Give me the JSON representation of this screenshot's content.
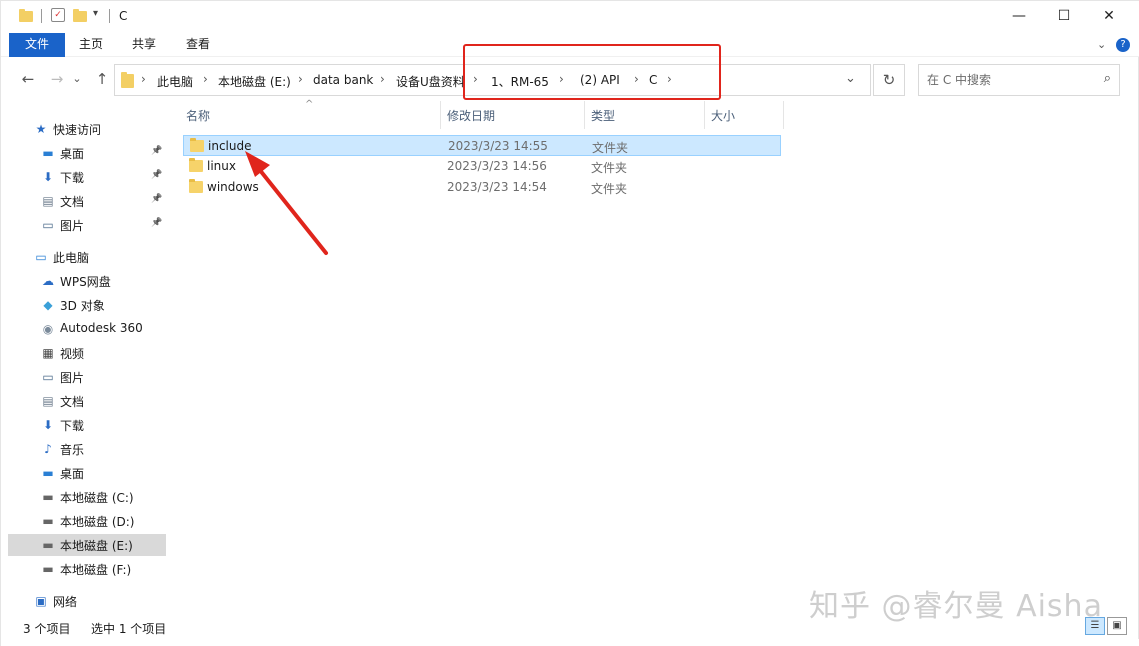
{
  "window": {
    "title": "C",
    "controls": {
      "minimize": "—",
      "maximize": "☐",
      "close": "✕"
    }
  },
  "ribbon": {
    "tabs": [
      "文件",
      "主页",
      "共享",
      "查看"
    ],
    "expand_icon": "chevron-down-icon",
    "help_icon": "?"
  },
  "navigation": {
    "back": "←",
    "forward": "→",
    "recent": "⌄",
    "up": "↑",
    "breadcrumbs": [
      "此电脑",
      "本地磁盘 (E:)",
      "data bank",
      "设备U盘资料",
      "1、RM-65",
      "(2) API",
      "C"
    ],
    "refresh": "↻",
    "search_placeholder": "在 C 中搜索"
  },
  "sidebar": {
    "items": [
      {
        "label": "快速访问",
        "icon": "star-icon",
        "pinned": false,
        "level": 0
      },
      {
        "label": "桌面",
        "icon": "desktop-icon",
        "pinned": true,
        "level": 1
      },
      {
        "label": "下载",
        "icon": "download-icon",
        "pinned": true,
        "level": 1
      },
      {
        "label": "文档",
        "icon": "document-icon",
        "pinned": true,
        "level": 1
      },
      {
        "label": "图片",
        "icon": "pictures-icon",
        "pinned": true,
        "level": 1
      },
      {
        "label": "此电脑",
        "icon": "computer-icon",
        "pinned": false,
        "level": 0
      },
      {
        "label": "WPS网盘",
        "icon": "cloud-icon",
        "pinned": false,
        "level": 1
      },
      {
        "label": "3D 对象",
        "icon": "cube-icon",
        "pinned": false,
        "level": 1
      },
      {
        "label": "Autodesk 360",
        "icon": "autodesk-icon",
        "pinned": false,
        "level": 1
      },
      {
        "label": "视频",
        "icon": "video-icon",
        "pinned": false,
        "level": 1
      },
      {
        "label": "图片",
        "icon": "pictures-icon",
        "pinned": false,
        "level": 1
      },
      {
        "label": "文档",
        "icon": "document-icon",
        "pinned": false,
        "level": 1
      },
      {
        "label": "下载",
        "icon": "download-icon",
        "pinned": false,
        "level": 1
      },
      {
        "label": "音乐",
        "icon": "music-icon",
        "pinned": false,
        "level": 1
      },
      {
        "label": "桌面",
        "icon": "desktop-icon",
        "pinned": false,
        "level": 1
      },
      {
        "label": "本地磁盘 (C:)",
        "icon": "drive-c-icon",
        "pinned": false,
        "level": 1
      },
      {
        "label": "本地磁盘 (D:)",
        "icon": "drive-icon",
        "pinned": false,
        "level": 1
      },
      {
        "label": "本地磁盘 (E:)",
        "icon": "drive-icon",
        "pinned": false,
        "level": 1,
        "selected": true
      },
      {
        "label": "本地磁盘 (F:)",
        "icon": "drive-icon",
        "pinned": false,
        "level": 1
      },
      {
        "label": "网络",
        "icon": "network-icon",
        "pinned": false,
        "level": 0
      }
    ]
  },
  "file_list": {
    "columns": [
      "名称",
      "修改日期",
      "类型",
      "大小"
    ],
    "rows": [
      {
        "name": "include",
        "date": "2023/3/23 14:55",
        "type": "文件夹",
        "selected": true
      },
      {
        "name": "linux",
        "date": "2023/3/23 14:56",
        "type": "文件夹",
        "selected": false
      },
      {
        "name": "windows",
        "date": "2023/3/23 14:54",
        "type": "文件夹",
        "selected": false
      }
    ]
  },
  "status": {
    "item_count": "3 个项目",
    "selection": "选中 1 个项目"
  },
  "watermark": "知乎 @睿尔曼 Aisha",
  "colors": {
    "accent": "#1a63c9",
    "selection": "#cce8ff",
    "annotation": "#e0251c",
    "folder": "#f6d36a"
  }
}
